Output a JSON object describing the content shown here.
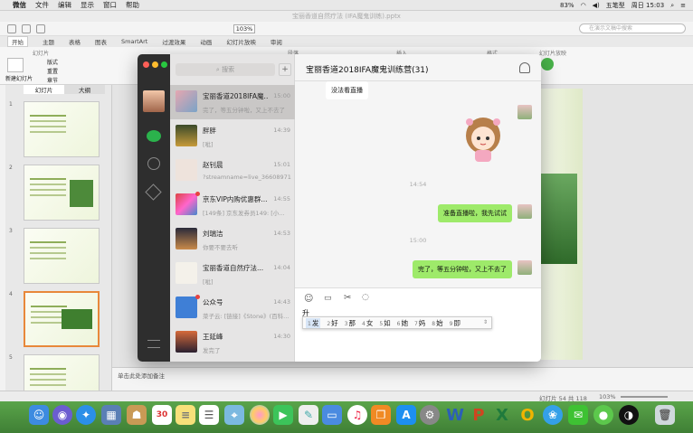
{
  "menubar": {
    "apple": "",
    "items": [
      "微信",
      "文件",
      "编辑",
      "显示",
      "窗口",
      "帮助"
    ],
    "battery": "83%",
    "ime_label": "五笔型",
    "clock": "周日 15:03"
  },
  "ppt": {
    "title": "宝丽香道自然疗法 (IFA魔鬼训练).pptx",
    "zoom": "103%",
    "search_placeholder": "在演示文稿中搜索",
    "ribbon_tabs": [
      "开始",
      "主题",
      "表格",
      "图表",
      "SmartArt",
      "过渡效果",
      "动画",
      "幻灯片放映",
      "审阅"
    ],
    "ribbon_groups": [
      "幻灯片",
      "段落",
      "插入",
      "格式",
      "幻灯片放映"
    ],
    "ribbon_buttons": [
      "新建幻灯片",
      "版式",
      "重置",
      "章节"
    ],
    "pane_tabs": [
      "幻灯片",
      "大纲"
    ],
    "slide_numbers": [
      "1",
      "2",
      "3",
      "4",
      "5"
    ],
    "notes_placeholder": "单击此处添加备注",
    "status": {
      "slide_info": "幻灯片 54 共 118",
      "zoom": "103%"
    }
  },
  "wechat": {
    "search_placeholder": "搜索",
    "add_label": "+",
    "chat_title": "宝丽香道2018IFA魔鬼训练营(31)",
    "chats": [
      {
        "name": "宝丽香道2018IFA魔...",
        "time": "15:00",
        "preview": "完了，等五分钟啦，又上不去了",
        "selected": true,
        "unread": false
      },
      {
        "name": "胖胖",
        "time": "14:39",
        "preview": "[呲]",
        "selected": false,
        "unread": false
      },
      {
        "name": "赵钊晨",
        "time": "15:01",
        "preview": "?streamname=live_366089715...",
        "selected": false,
        "unread": false
      },
      {
        "name": "京东VIP内购优惠群...",
        "time": "14:55",
        "preview": "[149条] 京东发券员149: [小...",
        "selected": false,
        "unread": true
      },
      {
        "name": "刘瑞洁",
        "time": "14:53",
        "preview": "你要不要去听",
        "selected": false,
        "unread": false
      },
      {
        "name": "宝丽香道自然疗法...",
        "time": "14:04",
        "preview": "[呲]",
        "selected": false,
        "unread": false
      },
      {
        "name": "公众号",
        "time": "14:43",
        "preview": "菜子云: [链接]《Stone》(百科...",
        "selected": false,
        "unread": true
      },
      {
        "name": "王延峰",
        "time": "14:30",
        "preview": "发完了",
        "selected": false,
        "unread": false
      }
    ],
    "messages": {
      "first_text": "没法看直播",
      "time_1": "14:54",
      "msg_1": "准备直播啦，我先试试",
      "time_2": "15:00",
      "msg_2": "完了，等五分钟啦，又上不去了"
    },
    "input_text": "升",
    "ime_candidates": [
      {
        "n": "1",
        "c": "发"
      },
      {
        "n": "2",
        "c": "好"
      },
      {
        "n": "3",
        "c": "那"
      },
      {
        "n": "4",
        "c": "女"
      },
      {
        "n": "5",
        "c": "如"
      },
      {
        "n": "6",
        "c": "她"
      },
      {
        "n": "7",
        "c": "妈"
      },
      {
        "n": "8",
        "c": "始"
      },
      {
        "n": "9",
        "c": "即"
      }
    ]
  },
  "dock": {
    "apps": [
      "finder-icon",
      "siri-icon",
      "safari-icon",
      "preview-icon",
      "photos-icon",
      "calendar-icon",
      "notes-icon",
      "reminders-icon",
      "maps-icon",
      "itunes-icon",
      "facetime-icon",
      "messages-icon",
      "keynote-icon",
      "music-icon",
      "books-icon",
      "appstore-icon",
      "settings-icon",
      "word-icon",
      "powerpoint-icon",
      "excel-icon",
      "outlook-icon",
      "qq-icon",
      "wechat-icon",
      "obs-icon",
      "trash-icon"
    ]
  }
}
